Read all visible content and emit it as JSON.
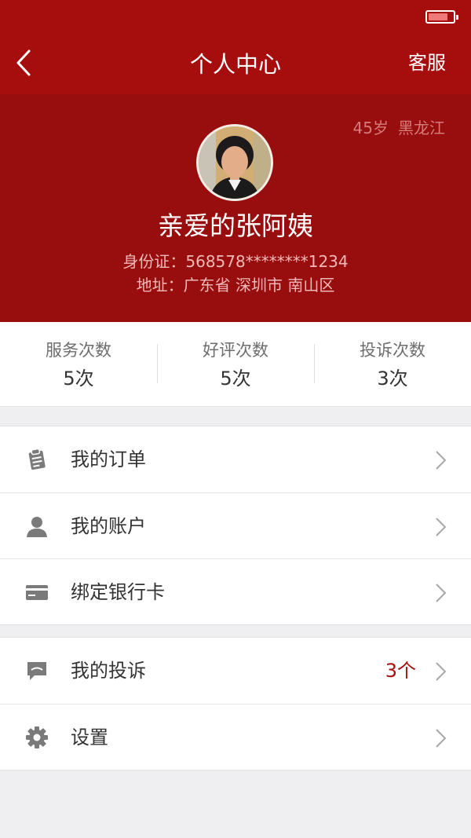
{
  "header": {
    "title": "个人中心",
    "right_action": "客服",
    "accent": "#a60e0e"
  },
  "profile": {
    "age": "45岁",
    "region": "黑龙江",
    "name": "亲爱的张阿姨",
    "id_line": "身份证：568578********1234",
    "address_line": "地址：广东省 深圳市 南山区"
  },
  "stats": [
    {
      "label": "服务次数",
      "value": "5次"
    },
    {
      "label": "好评次数",
      "value": "5次"
    },
    {
      "label": "投诉次数",
      "value": "3次"
    }
  ],
  "menu1": [
    {
      "label": "我的订单",
      "icon": "clipboard-icon"
    },
    {
      "label": "我的账户",
      "icon": "user-icon"
    },
    {
      "label": "绑定银行卡",
      "icon": "card-icon"
    }
  ],
  "menu2": [
    {
      "label": "我的投诉",
      "icon": "chat-icon",
      "badge": "3个"
    },
    {
      "label": "设置",
      "icon": "gear-icon"
    }
  ]
}
